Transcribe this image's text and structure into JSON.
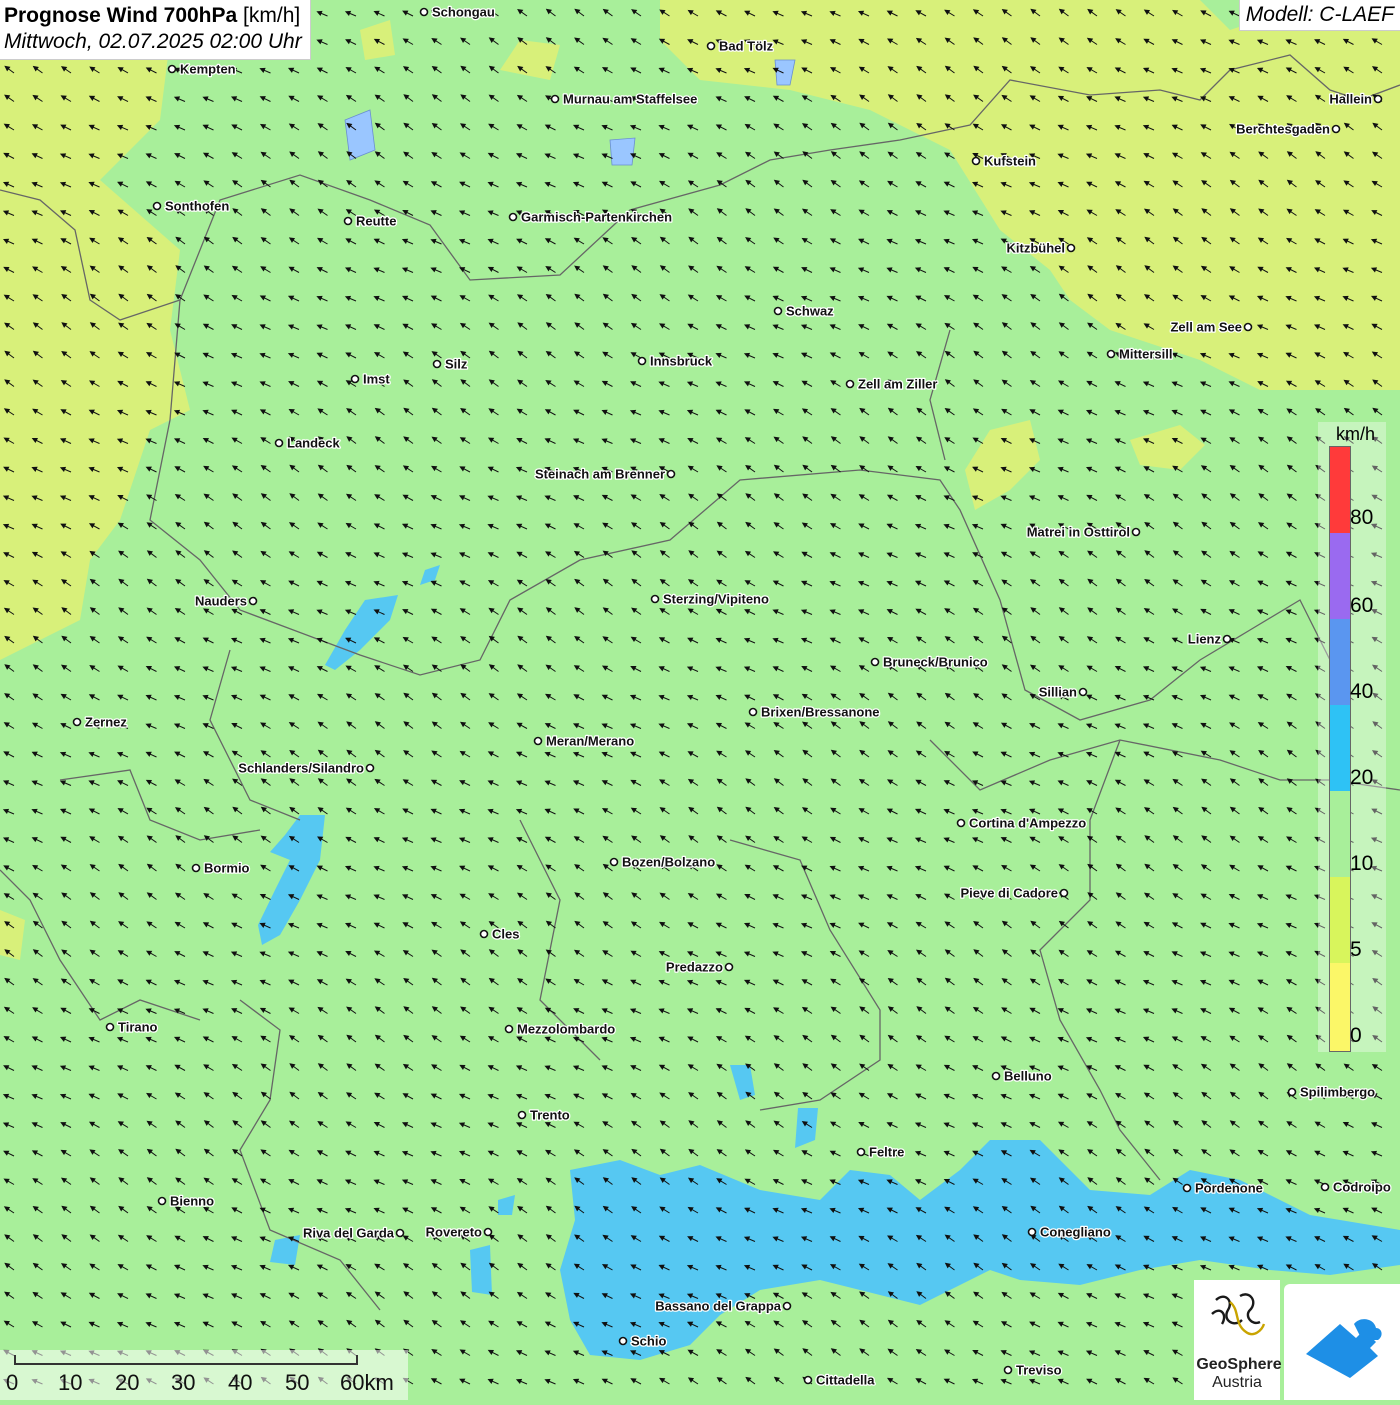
{
  "title": {
    "bold": "Prognose Wind 700hPa",
    "unit": " [km/h]",
    "date": "Mittwoch, 02.07.2025 02:00 Uhr"
  },
  "model": "Modell: C-LAEF",
  "legend": {
    "unit": "km/h",
    "ticks": [
      "80",
      "60",
      "40",
      "20",
      "10",
      "5",
      "0"
    ],
    "colors": [
      "#ff3a3a",
      "#9a6af0",
      "#5a96f0",
      "#2ec2f5",
      "#a8ef9a",
      "#d8f55c",
      "#fbf768"
    ]
  },
  "colors": {
    "calm_yellow": "#d8f07a",
    "light_green": "#a8ef9a",
    "blue_20": "#56c8f2"
  },
  "scale": {
    "labels": [
      "0",
      "10",
      "20",
      "30",
      "40",
      "50",
      "60km"
    ]
  },
  "logos": {
    "geosphere_line1": "GeoSphere",
    "geosphere_line2": "Austria"
  },
  "wind_direction": "from south-east (arrows pointing north-west)",
  "cities": [
    {
      "name": "Schongau"
    },
    {
      "name": "Bad Tölz"
    },
    {
      "name": "Kempten"
    },
    {
      "name": "Murnau am Staffelsee"
    },
    {
      "name": "Hallein"
    },
    {
      "name": "Berchtesgaden"
    },
    {
      "name": "Kufstein"
    },
    {
      "name": "Sonthofen"
    },
    {
      "name": "Reutte"
    },
    {
      "name": "Garmisch-Partenkirchen"
    },
    {
      "name": "Kitzbühel"
    },
    {
      "name": "Schwaz"
    },
    {
      "name": "Zell am See"
    },
    {
      "name": "Mittersill"
    },
    {
      "name": "Imst"
    },
    {
      "name": "Silz"
    },
    {
      "name": "Innsbruck"
    },
    {
      "name": "Zell am Ziller"
    },
    {
      "name": "Landeck"
    },
    {
      "name": "Steinach am Brenner"
    },
    {
      "name": "Matrei in Osttirol"
    },
    {
      "name": "Nauders"
    },
    {
      "name": "Sterzing/Vipiteno"
    },
    {
      "name": "Lienz"
    },
    {
      "name": "Bruneck/Brunico"
    },
    {
      "name": "Sillian"
    },
    {
      "name": "Zernez"
    },
    {
      "name": "Brixen/Bressanone"
    },
    {
      "name": "Meran/Merano"
    },
    {
      "name": "Schlanders/Silandro"
    },
    {
      "name": "Cortina d'Ampezzo"
    },
    {
      "name": "Bozen/Bolzano"
    },
    {
      "name": "Bormio"
    },
    {
      "name": "Pieve di Cadore"
    },
    {
      "name": "Cles"
    },
    {
      "name": "Predazzo"
    },
    {
      "name": "Tirano"
    },
    {
      "name": "Mezzolombardo"
    },
    {
      "name": "Belluno"
    },
    {
      "name": "Spilimbergo"
    },
    {
      "name": "Trento"
    },
    {
      "name": "Feltre"
    },
    {
      "name": "Pordenone"
    },
    {
      "name": "Codroipo"
    },
    {
      "name": "Bienno"
    },
    {
      "name": "Riva del Garda"
    },
    {
      "name": "Rovereto"
    },
    {
      "name": "Conegliano"
    },
    {
      "name": "Bassano del Grappa"
    },
    {
      "name": "Schio"
    },
    {
      "name": "Treviso"
    },
    {
      "name": "Cittadella"
    }
  ]
}
